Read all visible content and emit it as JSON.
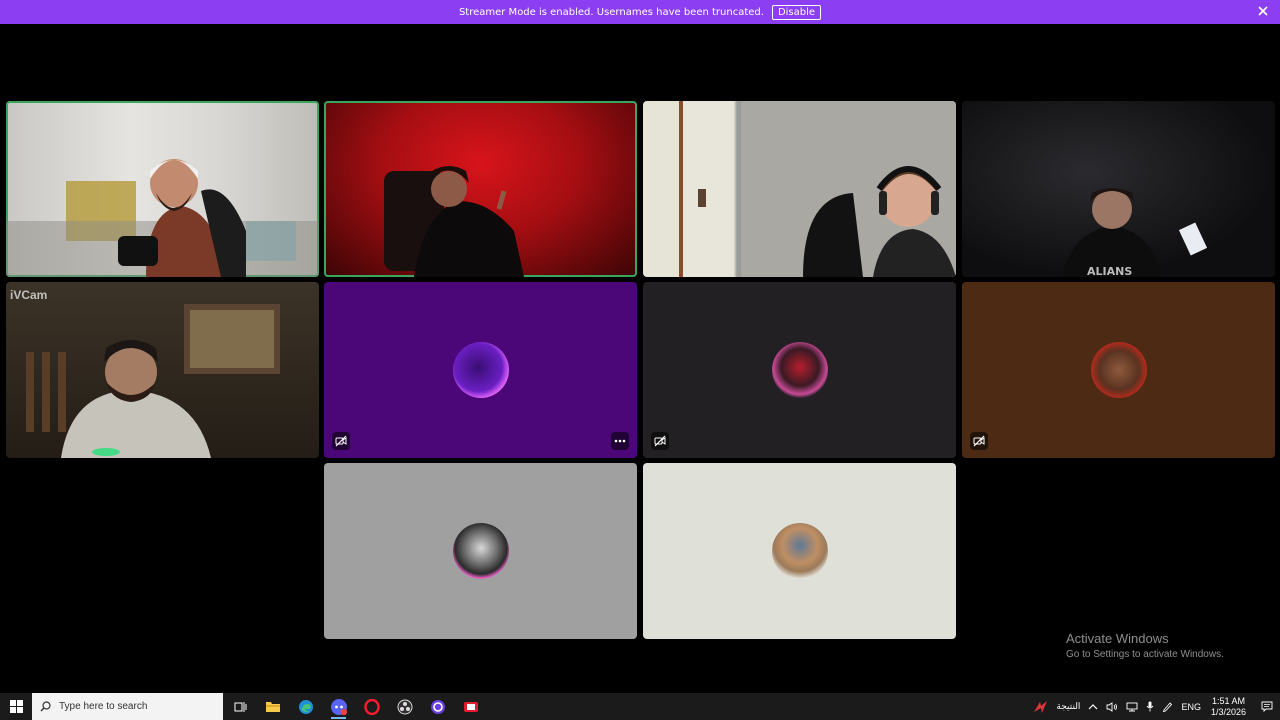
{
  "banner": {
    "message": "Streamer Mode is enabled. Usernames have been truncated.",
    "disable_label": "Disable"
  },
  "tiles": [
    {
      "id": "tile-1",
      "kind": "video",
      "speaking": true
    },
    {
      "id": "tile-2",
      "kind": "video",
      "speaking": true
    },
    {
      "id": "tile-3",
      "kind": "video",
      "speaking": false
    },
    {
      "id": "tile-4",
      "kind": "video",
      "speaking": false
    },
    {
      "id": "tile-5",
      "kind": "video",
      "label": "iVCam"
    },
    {
      "id": "tile-6",
      "kind": "avatar",
      "background": "#4b0677"
    },
    {
      "id": "tile-7",
      "kind": "avatar",
      "background": "#232023"
    },
    {
      "id": "tile-8",
      "kind": "avatar",
      "background": "#4d2a14"
    },
    {
      "id": "tile-9",
      "kind": "avatar",
      "background": "#a0a0a0"
    },
    {
      "id": "tile-10",
      "kind": "avatar",
      "background": "#dfe0d7"
    }
  ],
  "watermark": {
    "title": "Activate Windows",
    "subtitle": "Go to Settings to activate Windows."
  },
  "taskbar": {
    "search_placeholder": "Type here to search",
    "apps": [
      "task-view",
      "file-explorer",
      "edge",
      "discord",
      "opera",
      "obs",
      "app-purple",
      "app-red"
    ],
    "weather_label": "النتيجة",
    "language": "ENG",
    "time": "1:51 AM",
    "date": "1/3/2026"
  },
  "colors": {
    "banner": "#8c3ff2",
    "speaking_ring": "#3ba55c"
  }
}
